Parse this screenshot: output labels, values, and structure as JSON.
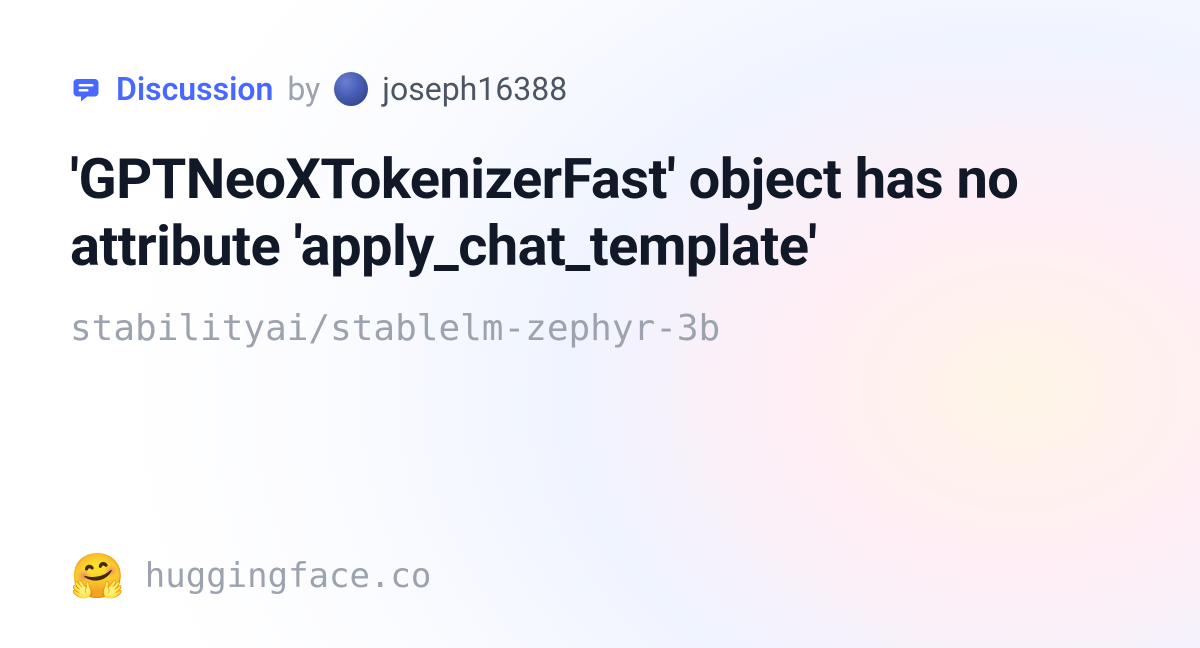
{
  "header": {
    "discussion_label": "Discussion",
    "by_label": "by",
    "username": "joseph16388"
  },
  "title": "'GPTNeoXTokenizerFast' object has no attribute 'apply_chat_template'",
  "repo_path": "stabilityai/stablelm-zephyr-3b",
  "footer": {
    "emoji": "🤗",
    "site": "huggingface.co"
  }
}
